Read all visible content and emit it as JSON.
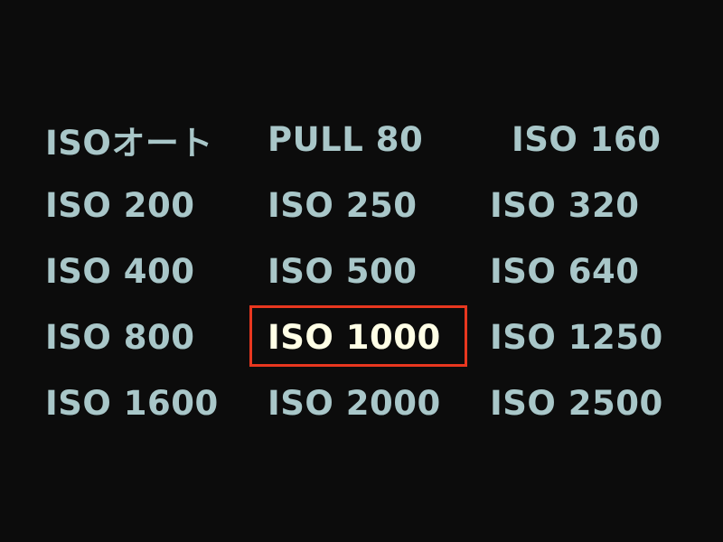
{
  "menu": {
    "options": [
      {
        "label": "ISOオート"
      },
      {
        "label": "PULL 80"
      },
      {
        "label": "ISO 160"
      },
      {
        "label": "ISO 200"
      },
      {
        "label": "ISO 250"
      },
      {
        "label": "ISO 320"
      },
      {
        "label": "ISO 400"
      },
      {
        "label": "ISO 500"
      },
      {
        "label": "ISO 640"
      },
      {
        "label": "ISO 800"
      },
      {
        "label": "ISO 1000"
      },
      {
        "label": "ISO 1250"
      },
      {
        "label": "ISO 1600"
      },
      {
        "label": "ISO 2000"
      },
      {
        "label": "ISO 2500"
      }
    ],
    "selected": "ISO 1000"
  },
  "colors": {
    "background": "#0c0c0c",
    "option_text": "#a9c7c9",
    "selected_text": "#ffffe6",
    "selection_border": "#e8371f"
  }
}
